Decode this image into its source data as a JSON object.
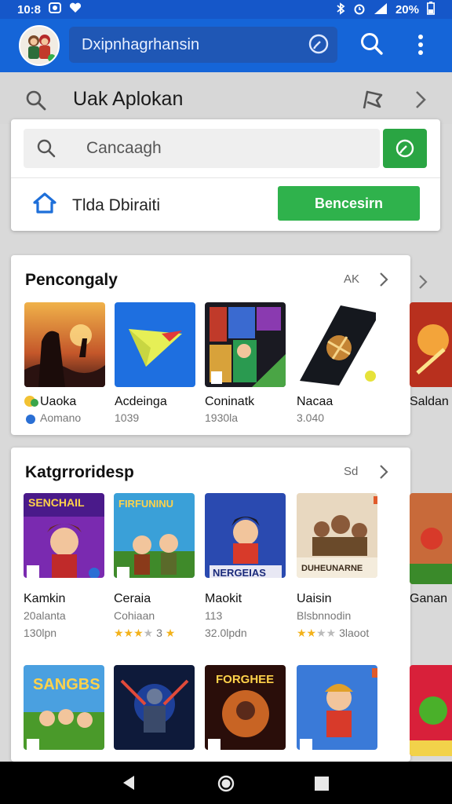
{
  "status_bar": {
    "time": "10:8",
    "battery": "20%"
  },
  "app_bar": {
    "search_text": "Dxipnhagrhansin"
  },
  "sub_bar": {
    "title": "Uak Aplokan"
  },
  "search_panel": {
    "placeholder": "Cancaagh",
    "home_label": "Tlda Dbiraiti",
    "action_label": "Bencesirn"
  },
  "personal_section": {
    "title": "Pencongaly",
    "more_label": "AK",
    "apps": [
      {
        "name": "Uaoka",
        "sub": "Aomano"
      },
      {
        "name": "Acdeinga",
        "sub": "1039"
      },
      {
        "name": "Coninatk",
        "sub": "1930la"
      },
      {
        "name": "Nacaa",
        "sub": "3.040"
      }
    ],
    "peek": {
      "name": "Saldan",
      "sub": ""
    }
  },
  "categories_section": {
    "title": "Katgrroridesp",
    "more_label": "Sd",
    "apps": [
      {
        "name": "Kamkin",
        "sub": "20alanta",
        "sub2": "130lpn",
        "banner": "SENCHAIL",
        "stars_on": 0
      },
      {
        "name": "Ceraia",
        "sub": "Cohiaan",
        "sub2": "3",
        "banner": "FIRFUNINU",
        "stars_on": 3
      },
      {
        "name": "Maokit",
        "sub": "113",
        "sub2": "32.0lpdn",
        "banner": "NERGEIAS",
        "stars_on": 0
      },
      {
        "name": "Uaisin",
        "sub": "Blsbnnodin",
        "sub2": "3laoot",
        "banner": "DUHEUNARNE",
        "stars_on": 2
      }
    ],
    "row2": [
      {
        "banner": "SANGBS"
      },
      {
        "banner": ""
      },
      {
        "banner": "FORGHEE"
      },
      {
        "banner": ""
      }
    ],
    "peek": {
      "name": "Ganan"
    }
  },
  "colors": {
    "app_bar": "#1565d8",
    "accent_green": "#2fb24c",
    "background": "#d9d9d9"
  }
}
